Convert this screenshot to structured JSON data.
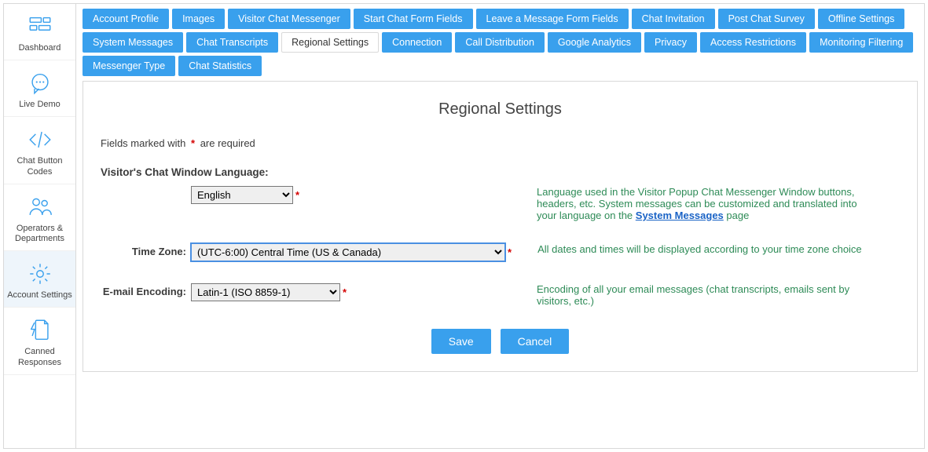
{
  "sidebar": {
    "items": [
      {
        "id": "dashboard",
        "label": "Dashboard",
        "icon": "dashboard",
        "active": false
      },
      {
        "id": "livedemo",
        "label": "Live Demo",
        "icon": "chat",
        "active": false
      },
      {
        "id": "buttoncodes",
        "label": "Chat Button Codes",
        "icon": "code",
        "active": false
      },
      {
        "id": "operators",
        "label": "Operators & Departments",
        "icon": "people",
        "active": false
      },
      {
        "id": "account",
        "label": "Account Settings",
        "icon": "gear",
        "active": true
      },
      {
        "id": "canned",
        "label": "Canned Responses",
        "icon": "bolt-file",
        "active": false
      }
    ]
  },
  "tabs": [
    {
      "label": "Account Profile",
      "active": false
    },
    {
      "label": "Images",
      "active": false
    },
    {
      "label": "Visitor Chat Messenger",
      "active": false
    },
    {
      "label": "Start Chat Form Fields",
      "active": false
    },
    {
      "label": "Leave a Message Form Fields",
      "active": false
    },
    {
      "label": "Chat Invitation",
      "active": false
    },
    {
      "label": "Post Chat Survey",
      "active": false
    },
    {
      "label": "Offline Settings",
      "active": false
    },
    {
      "label": "System Messages",
      "active": false
    },
    {
      "label": "Chat Transcripts",
      "active": false
    },
    {
      "label": "Regional Settings",
      "active": true
    },
    {
      "label": "Connection",
      "active": false
    },
    {
      "label": "Call Distribution",
      "active": false
    },
    {
      "label": "Google Analytics",
      "active": false
    },
    {
      "label": "Privacy",
      "active": false
    },
    {
      "label": "Access Restrictions",
      "active": false
    },
    {
      "label": "Monitoring Filtering",
      "active": false
    },
    {
      "label": "Messenger Type",
      "active": false
    },
    {
      "label": "Chat Statistics",
      "active": false
    }
  ],
  "page": {
    "title": "Regional Settings",
    "required_prefix": "Fields marked with",
    "required_suffix": "are required",
    "section_language_heading": "Visitor's Chat Window Language:",
    "labels": {
      "timezone": "Time Zone:",
      "encoding": "E-mail Encoding:"
    },
    "fields": {
      "language": {
        "value": "English"
      },
      "timezone": {
        "value": "(UTC-6:00) Central Time (US & Canada)"
      },
      "encoding": {
        "value": "Latin-1 (ISO 8859-1)"
      }
    },
    "help": {
      "language_a": "Language used in the Visitor Popup Chat Messenger Window buttons, headers, etc. System messages can be customized and translated into your language on the ",
      "language_link": "System Messages",
      "language_b": " page",
      "timezone": "All dates and times will be displayed according to your time zone choice",
      "encoding": "Encoding of all your email messages (chat transcripts, emails sent by visitors, etc.)"
    },
    "buttons": {
      "save": "Save",
      "cancel": "Cancel"
    }
  }
}
